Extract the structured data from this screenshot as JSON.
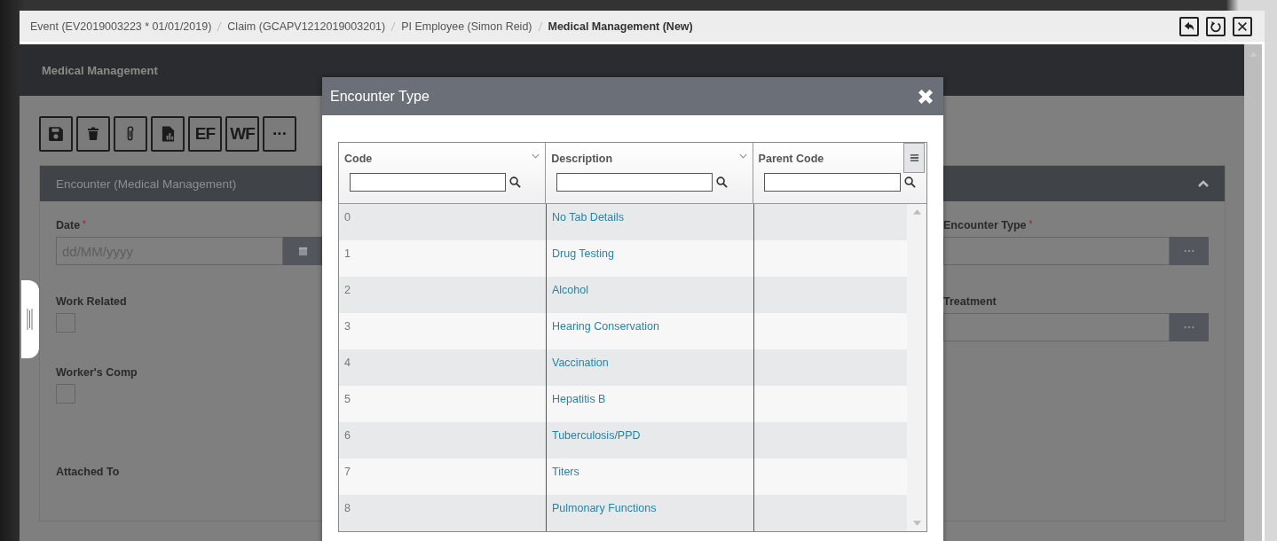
{
  "breadcrumb": [
    {
      "label": "Event (EV2019003223 * 01/01/2019)",
      "current": false
    },
    {
      "label": "Claim (GCAPV1212019003201)",
      "current": false
    },
    {
      "label": "PI Employee (Simon Reid)",
      "current": false
    },
    {
      "label": "Medical Management (New)",
      "current": true
    }
  ],
  "window_buttons": [
    {
      "kind": "back"
    },
    {
      "kind": "refresh"
    },
    {
      "kind": "close"
    }
  ],
  "header": {
    "title": "Medical Management"
  },
  "toolbar": [
    {
      "kind": "save"
    },
    {
      "kind": "delete"
    },
    {
      "kind": "attach"
    },
    {
      "kind": "report"
    },
    {
      "kind": "text",
      "label": "EF"
    },
    {
      "kind": "text",
      "label": "WF"
    },
    {
      "kind": "text",
      "label": "···"
    }
  ],
  "section": {
    "title": "Encounter (Medical Management)",
    "expanded": true
  },
  "fields_left": [
    {
      "kind": "date",
      "label": "Date",
      "required_mark": "*",
      "placeholder": "dd/MM/yyyy"
    },
    {
      "kind": "checkbox",
      "label": "Work Related",
      "checked": false
    },
    {
      "kind": "checkbox",
      "label": "Worker's Comp",
      "checked": false
    },
    {
      "kind": "label",
      "label": "Attached To"
    }
  ],
  "fields_right": [
    {
      "kind": "lookup",
      "label": "Encounter Type",
      "required_mark": "*"
    },
    {
      "kind": "lookup",
      "label": "Treatment"
    }
  ],
  "modal": {
    "title": "Encounter Type",
    "columns": [
      {
        "label": "Code"
      },
      {
        "label": "Description"
      },
      {
        "label": "Parent Code"
      }
    ],
    "rows": [
      {
        "code": "0",
        "description": "No Tab Details"
      },
      {
        "code": "1",
        "description": "Drug Testing"
      },
      {
        "code": "2",
        "description": "Alcohol"
      },
      {
        "code": "3",
        "description": "Hearing Conservation"
      },
      {
        "code": "4",
        "description": "Vaccination"
      },
      {
        "code": "5",
        "description": "Hepatitis B"
      },
      {
        "code": "6",
        "description": "Tuberculosis/PPD"
      },
      {
        "code": "7",
        "description": "Titers"
      },
      {
        "code": "8",
        "description": "Pulmonary Functions"
      }
    ]
  }
}
